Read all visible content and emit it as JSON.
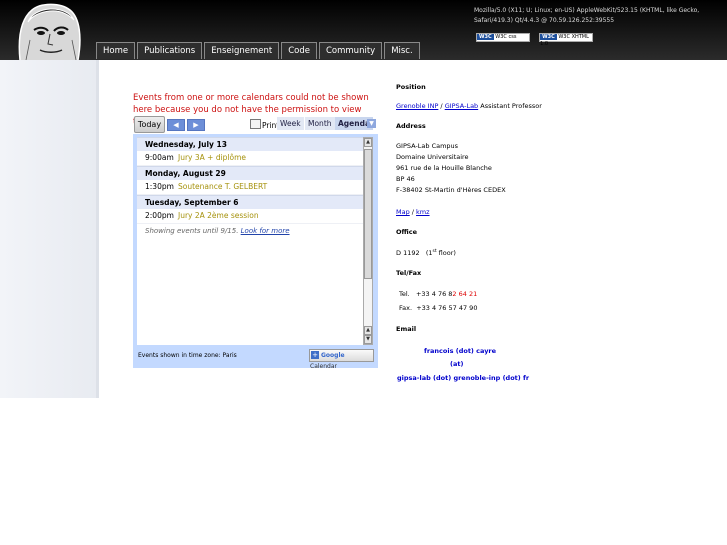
{
  "user_agent": "Mozilla/5.0 (X11; U; Linux; en-US) AppleWebKit/523.15 (KHTML, like Gecko, Safari/419.3) Qt/4.4.3 @ 70.59.126.252:39555",
  "badges": {
    "css": "W3C css",
    "xhtml": "W3C XHTML 1.0"
  },
  "nav": [
    "Home",
    "Publications",
    "Enseignement",
    "Code",
    "Community",
    "Misc."
  ],
  "calendar": {
    "error_message": "Events from one or more calendars could not be shown here because you do not have the permission to view them.",
    "today": "Today",
    "prev": "◀",
    "next": "▶",
    "print": "Print",
    "tabs": {
      "week": "Week",
      "month": "Month",
      "agenda": "Agenda"
    },
    "days": [
      {
        "date": "Wednesday, July 13",
        "events": [
          {
            "time": "9:00am",
            "title": "Jury 3A + diplôme"
          }
        ]
      },
      {
        "date": "Monday, August 29",
        "events": [
          {
            "time": "1:30pm",
            "title": "Soutenance T. GELBERT"
          }
        ]
      },
      {
        "date": "Tuesday, September 6",
        "events": [
          {
            "time": "2:00pm",
            "title": "Jury 2A 2ème session"
          }
        ]
      }
    ],
    "showing_prefix": "Showing events until 9/15. ",
    "look_more": "Look for more",
    "timezone": "Events shown in time zone: Paris",
    "google": "Google",
    "google_calendar": "Calendar"
  },
  "info": {
    "position_title": "Position",
    "grenoble_inp": "Grenoble INP",
    "slash": " / ",
    "gipsa_lab": "GIPSA-Lab",
    "role": " Assistant Professor",
    "address_title": "Address",
    "address_lines": [
      "GIPSA-Lab Campus",
      "Domaine Universitaire",
      "961 rue de la Houille Blanche",
      "BP 46",
      "F-38402 St-Martin d'Hères CEDEX"
    ],
    "map": "Map",
    "kmz": "kmz",
    "office_title": "Office",
    "office_room": "D 1192",
    "office_floor_pre": "(1",
    "office_floor_sup": "st",
    "office_floor_post": " floor)",
    "telfax_title": "Tel/Fax",
    "tel_label": "Tel.",
    "tel_black": "+33 4 76 8",
    "tel_red": "2 64 21",
    "fax_label": "Fax.",
    "fax_number": "+33 4 76 57 47 90",
    "email_title": "Email",
    "email_1": "francois (dot) cayre",
    "email_2": "(at)",
    "email_3": "gipsa-lab (dot) grenoble-inp (dot) fr"
  }
}
